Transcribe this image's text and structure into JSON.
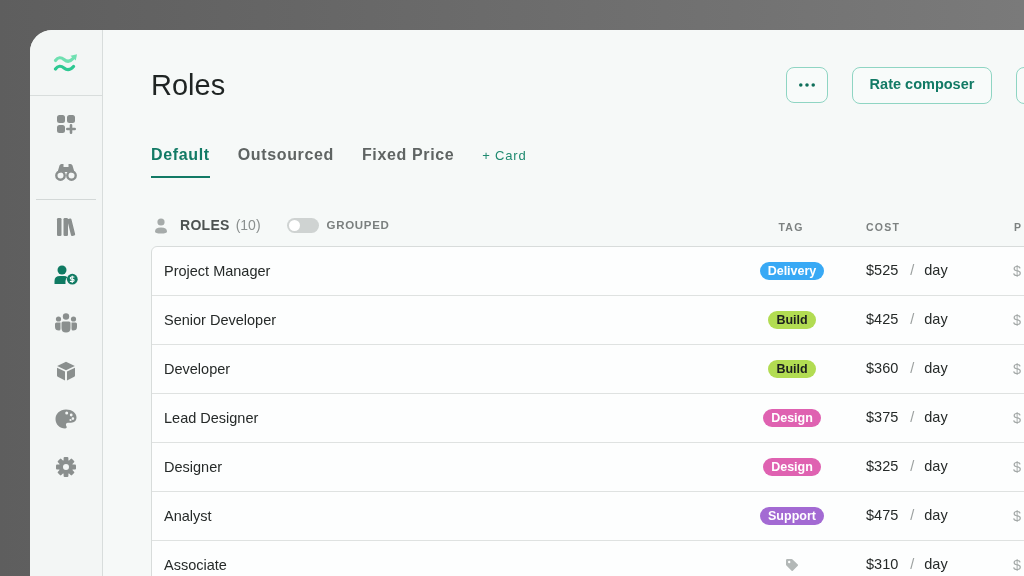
{
  "sidebar": {
    "groups": [
      {
        "items": [
          {
            "selected": false
          },
          {
            "selected": false
          }
        ]
      },
      {
        "items": [
          {
            "selected": false
          },
          {
            "selected": true
          },
          {
            "selected": false
          },
          {
            "selected": false
          },
          {
            "selected": false
          },
          {
            "selected": false
          }
        ]
      }
    ]
  },
  "header": {
    "title": "Roles",
    "buttons": [
      {
        "kind": "more"
      },
      {
        "kind": "text",
        "label": "Rate composer"
      },
      {
        "kind": "text"
      }
    ]
  },
  "tabs": [
    {
      "label": "Default",
      "selected": true
    },
    {
      "label": "Outsourced",
      "selected": false
    },
    {
      "label": "Fixed Price",
      "selected": false
    }
  ],
  "add_tab": {
    "label": "+ Card"
  },
  "table": {
    "title": "ROLES",
    "count": "(10)",
    "grouped_toggle": {
      "label": "GROUPED",
      "on": false
    },
    "columns": [
      {
        "label": "TAG"
      },
      {
        "label": "COST"
      },
      {
        "label": "P"
      }
    ],
    "rows": [
      {
        "name": "Project Manager",
        "tag": {
          "label": "Delivery",
          "color": "#38a9f5"
        },
        "cost": {
          "amount": "$525",
          "separator": "/",
          "unit": "day"
        },
        "column_3": "$"
      },
      {
        "name": "Senior Developer",
        "tag": {
          "label": "Build",
          "color": "#b2dc52"
        },
        "cost": {
          "amount": "$425",
          "separator": "/",
          "unit": "day"
        },
        "column_3": "$"
      },
      {
        "name": "Developer",
        "tag": {
          "label": "Build",
          "color": "#b2dc52"
        },
        "cost": {
          "amount": "$360",
          "separator": "/",
          "unit": "day"
        },
        "column_3": "$"
      },
      {
        "name": "Lead Designer",
        "tag": {
          "label": "Design",
          "color": "#df62b1"
        },
        "cost": {
          "amount": "$375",
          "separator": "/",
          "unit": "day"
        },
        "column_3": "$"
      },
      {
        "name": "Designer",
        "tag": {
          "label": "Design",
          "color": "#df62b1"
        },
        "cost": {
          "amount": "$325",
          "separator": "/",
          "unit": "day"
        },
        "column_3": "$"
      },
      {
        "name": "Analyst",
        "tag": {
          "label": "Support",
          "color": "#a36ad3"
        },
        "cost": {
          "amount": "$475",
          "separator": "/",
          "unit": "day"
        },
        "column_3": "$"
      },
      {
        "name": "Associate",
        "cost": {
          "amount": "$310",
          "separator": "/",
          "unit": "day"
        },
        "column_3": "$"
      }
    ]
  }
}
